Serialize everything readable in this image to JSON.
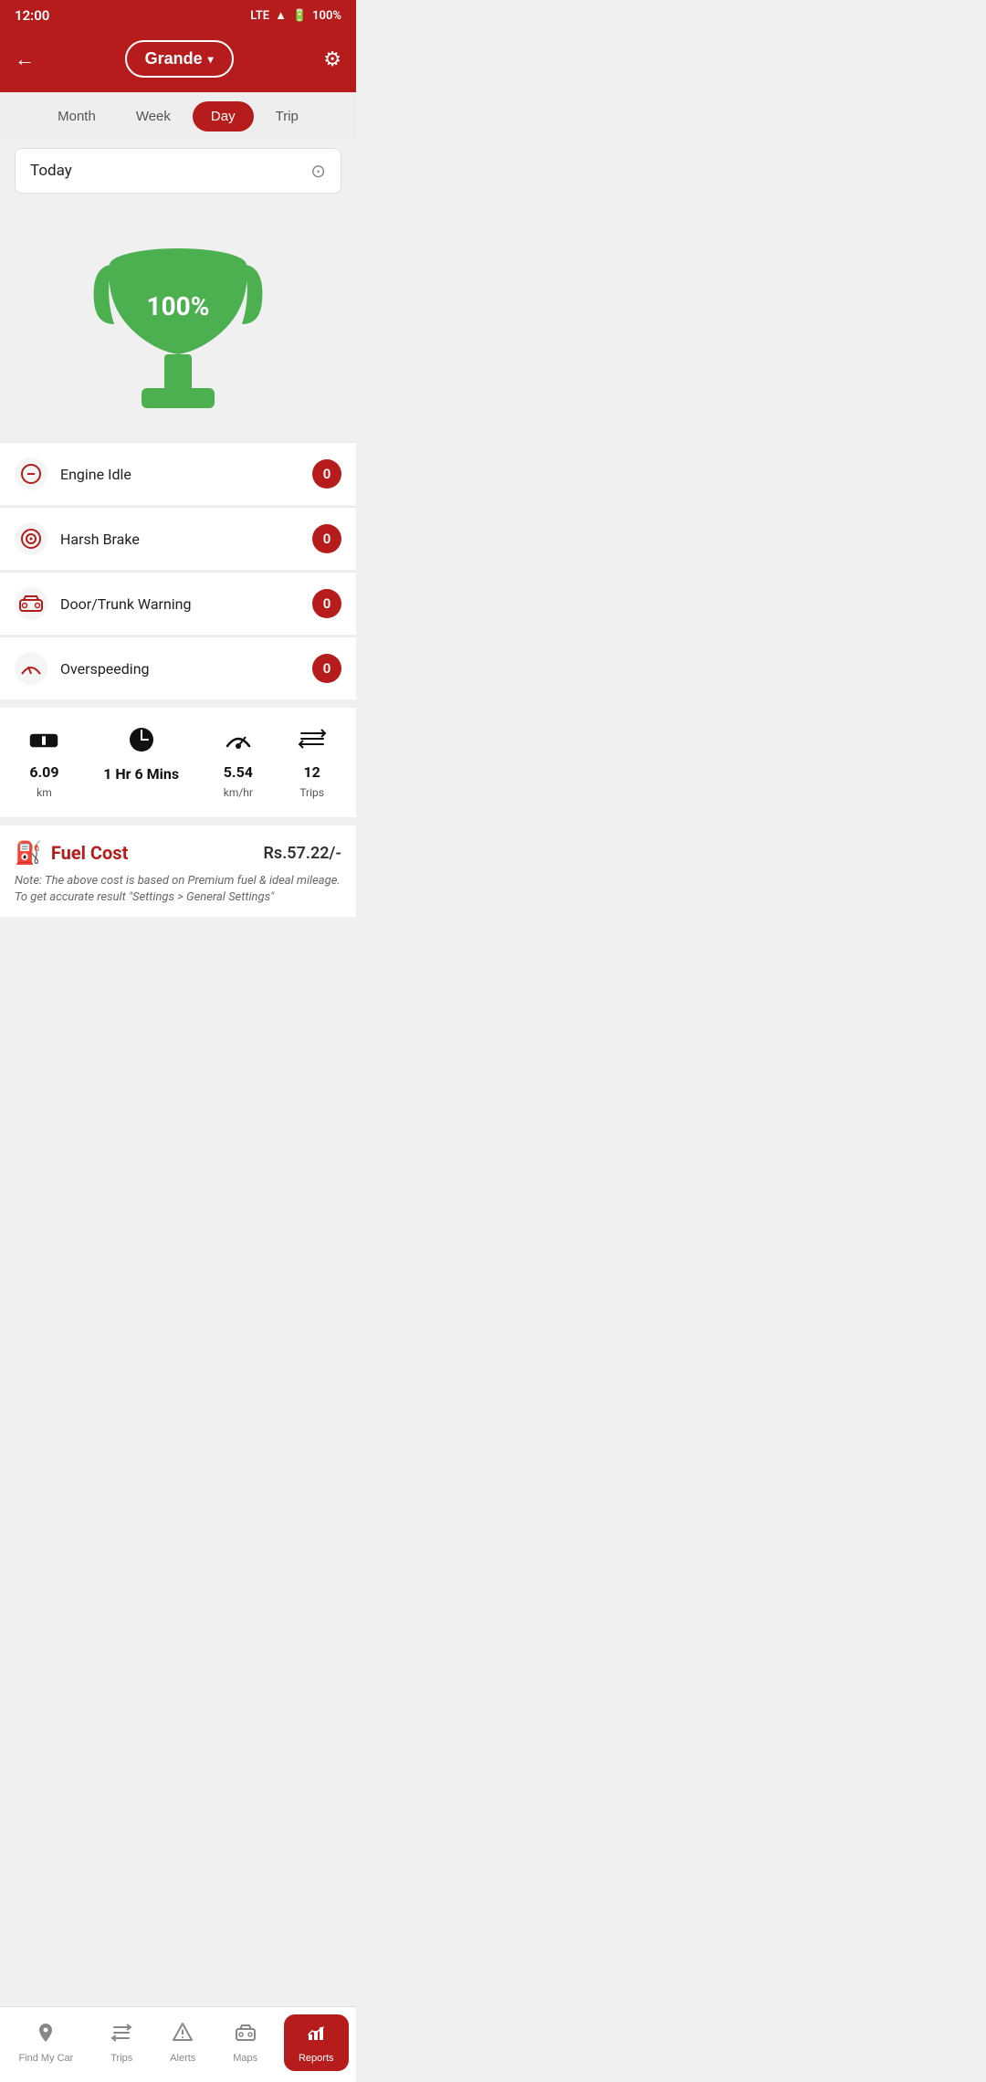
{
  "statusBar": {
    "time": "12:00",
    "signal": "LTE",
    "battery": "100%"
  },
  "header": {
    "backLabel": "←",
    "vehicleName": "Grande",
    "chevron": "▲",
    "settingsIcon": "⚙"
  },
  "tabs": [
    {
      "id": "month",
      "label": "Month",
      "active": false
    },
    {
      "id": "week",
      "label": "Week",
      "active": false
    },
    {
      "id": "day",
      "label": "Day",
      "active": true
    },
    {
      "id": "trip",
      "label": "Trip",
      "active": false
    }
  ],
  "dateSelector": {
    "value": "Today",
    "dropdownIcon": "⊕"
  },
  "trophy": {
    "percent": "100%"
  },
  "alerts": [
    {
      "id": "engine-idle",
      "label": "Engine Idle",
      "count": "0",
      "icon": "🔴"
    },
    {
      "id": "harsh-brake",
      "label": "Harsh Brake",
      "count": "0",
      "icon": "🎯"
    },
    {
      "id": "door-trunk",
      "label": "Door/Trunk Warning",
      "count": "0",
      "icon": "🚗"
    },
    {
      "id": "overspeeding",
      "label": "Overspeeding",
      "count": "0",
      "icon": "⚡"
    }
  ],
  "stats": [
    {
      "id": "distance",
      "icon": "🛣",
      "value": "6.09",
      "unit": "km"
    },
    {
      "id": "duration",
      "icon": "🕐",
      "value": "1 Hr 6 Mins",
      "unit": ""
    },
    {
      "id": "speed",
      "icon": "🔄",
      "value": "5.54",
      "unit": "km/hr"
    },
    {
      "id": "trips",
      "icon": "⇄",
      "value": "12",
      "unit": "Trips"
    }
  ],
  "fuelCost": {
    "icon": "⛽",
    "title": "Fuel Cost",
    "amount": "Rs.57.22/-",
    "note": "Note: The above cost is based on Premium fuel & ideal mileage. To get accurate result \"Settings > General Settings\""
  },
  "bottomNav": [
    {
      "id": "find-my-car",
      "label": "Find My Car",
      "icon": "📍",
      "active": false
    },
    {
      "id": "trips",
      "label": "Trips",
      "icon": "⇄",
      "active": false
    },
    {
      "id": "alerts",
      "label": "Alerts",
      "icon": "⚠",
      "active": false
    },
    {
      "id": "maps",
      "label": "Maps",
      "icon": "🚗",
      "active": false
    },
    {
      "id": "reports",
      "label": "Reports",
      "icon": "📊",
      "active": true
    }
  ],
  "colors": {
    "primary": "#b71c1c",
    "active_tab_bg": "#b71c1c",
    "trophy_green": "#4caf50",
    "badge_bg": "#b71c1c"
  }
}
